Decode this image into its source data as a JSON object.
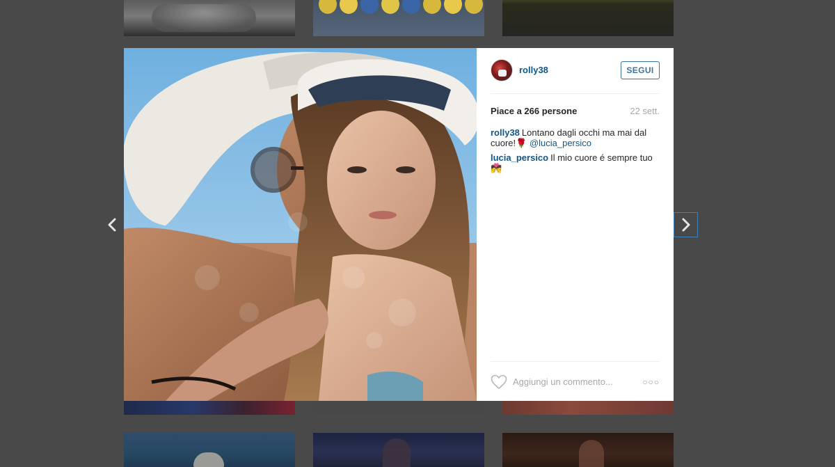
{
  "post": {
    "username": "rolly38",
    "follow_label": "SEGUI",
    "likes": "Piace a 266 persone",
    "date": "22 sett.",
    "comments": [
      {
        "user": "rolly38",
        "text": "Lontano dagli occhi ma mai dal cuore!🌹 ",
        "mention": "@lucia_persico"
      },
      {
        "user": "lucia_persico",
        "text": "Il mio cuore é sempre tuo💏"
      }
    ],
    "add_comment_placeholder": "Aggiungi un commento...",
    "more_label": "○○○"
  },
  "icons": {
    "prev": "chevron-left-icon",
    "next": "chevron-right-icon",
    "like": "heart-icon",
    "more": "ellipsis-icon"
  },
  "colors": {
    "link": "#125688",
    "follow": "#3f729b",
    "muted": "#a5a7aa",
    "backdrop": "#494949"
  }
}
